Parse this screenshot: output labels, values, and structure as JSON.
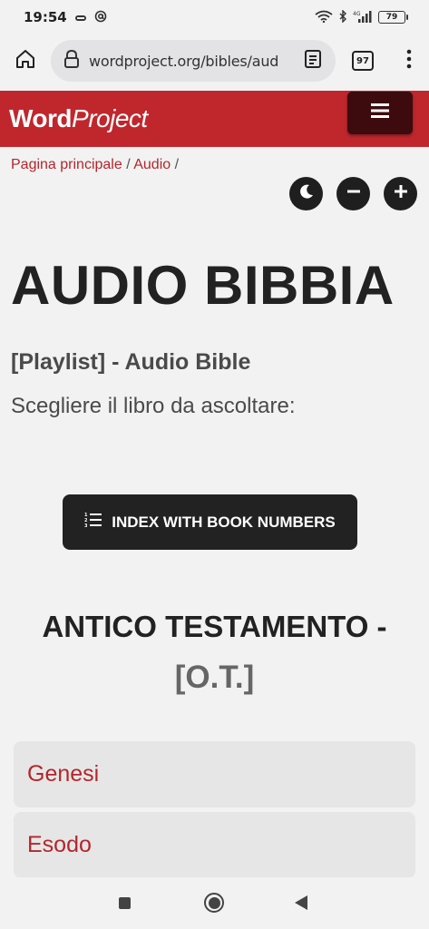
{
  "status_bar": {
    "time": "19:54",
    "battery": "79"
  },
  "browser": {
    "url": "wordproject.org/bibles/aud",
    "tab_count": "97"
  },
  "header": {
    "logo_part1": "Word",
    "logo_part2": "Project"
  },
  "breadcrumb": {
    "home": "Pagina principale",
    "sep1": "/",
    "current": "Audio",
    "sep2": "/"
  },
  "page": {
    "title": "AUDIO BIBBIA",
    "subtitle": "[Playlist] - Audio Bible",
    "instruction": "Scegliere il libro da ascoltare:",
    "index_button": "INDEX WITH BOOK NUMBERS",
    "section_heading": "ANTICO TESTAMENTO -",
    "section_sub": "[O.T.]"
  },
  "books": [
    "Genesi",
    "Esodo"
  ],
  "colors": {
    "brand_red": "#c0272d",
    "link_red": "#b3262c",
    "dark": "#222222"
  },
  "icons": [
    "home-icon",
    "lock-icon",
    "reader-mode-icon",
    "more-vert-icon",
    "menu-icon",
    "moon-icon",
    "minus-icon",
    "plus-icon",
    "list-numbered-icon"
  ]
}
